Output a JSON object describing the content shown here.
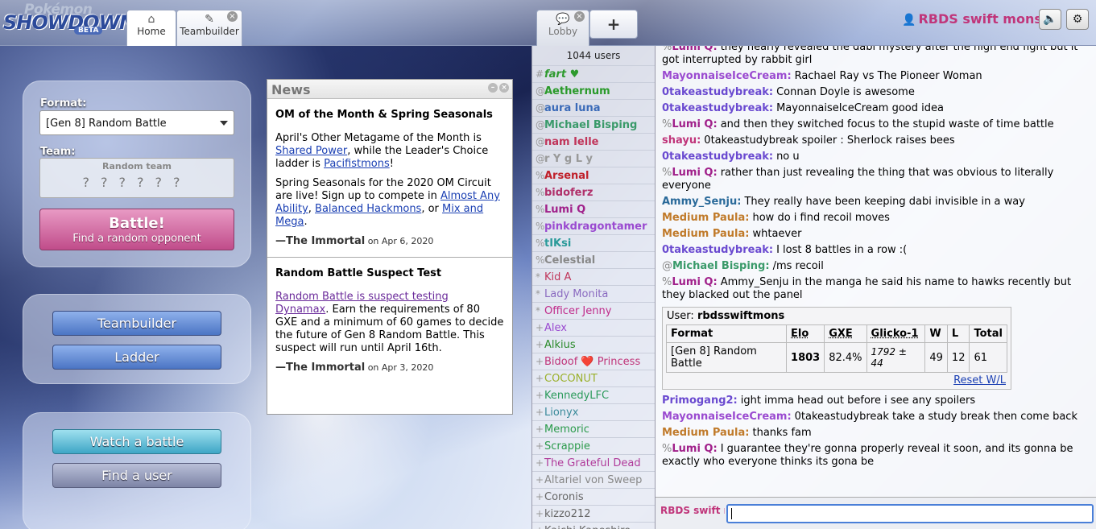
{
  "header": {
    "logo_top": "Pokémon",
    "logo_main": "SHOWDOWN",
    "logo_badge": "BETA",
    "tabs": [
      {
        "label": "Home"
      },
      {
        "label": "Teambuilder"
      },
      {
        "label": "Lobby"
      }
    ],
    "new_tab": "+",
    "username": "RBDS swift mons"
  },
  "menu": {
    "format_label": "Format:",
    "format_value": "[Gen 8] Random Battle",
    "team_label": "Team:",
    "team_value": "Random team",
    "battle_label": "Battle!",
    "battle_sub": "Find a random opponent",
    "teambuilder": "Teambuilder",
    "ladder": "Ladder",
    "watch": "Watch a battle",
    "find_user": "Find a user"
  },
  "news": {
    "title": "News",
    "items": [
      {
        "headline": "OM of the Month & Spring Seasonals",
        "p1_a": "April's Other Metagame of the Month is ",
        "p1_link1": "Shared Power",
        "p1_b": ", while the Leader's Choice ladder is ",
        "p1_link2": "Pacifistmons",
        "p1_c": "!",
        "p2_a": "Spring Seasonals for the 2020 OM Circuit are live! Sign up to compete in ",
        "p2_link1": "Almost Any Ability",
        "p2_b": ", ",
        "p2_link2": "Balanced Hackmons",
        "p2_c": ", or ",
        "p2_link3": "Mix and Mega",
        "p2_d": ".",
        "author": "—The Immortal",
        "date": "on Apr 6, 2020"
      },
      {
        "headline": "Random Battle Suspect Test",
        "p1_link1": "Random Battle is suspect testing Dynamax",
        "p1_a": ". Earn the requirements of 80 GXE and a minimum of 60 games to decide the future of Gen 8 Random Battle. This suspect will run until April 16th.",
        "author": "—The Immortal",
        "date": "on Apr 3, 2020"
      }
    ]
  },
  "userlist": {
    "count": "1044 users",
    "users": [
      {
        "rank": "#",
        "name": "fart ♥",
        "color": "#2e9a2e"
      },
      {
        "rank": "@",
        "name": "Aethernum",
        "color": "#2a9a2a"
      },
      {
        "rank": "@",
        "name": "aura luna",
        "color": "#3a6ab8"
      },
      {
        "rank": "@",
        "name": "Michael Bisping",
        "color": "#3a9a6a"
      },
      {
        "rank": "@",
        "name": "nam Ielle",
        "color": "#c0355a"
      },
      {
        "rank": "@",
        "name": "r Y g L y",
        "color": "#999999"
      },
      {
        "rank": "%",
        "name": "Arsenal",
        "color": "#c0202a"
      },
      {
        "rank": "%",
        "name": "bidoferz",
        "color": "#b0306a"
      },
      {
        "rank": "%",
        "name": "Lumi Q",
        "color": "#a0208a"
      },
      {
        "rank": "%",
        "name": "pinkdragontamer",
        "color": "#9a4ad0"
      },
      {
        "rank": "%",
        "name": "tIKsi",
        "color": "#2a9a9a"
      },
      {
        "rank": "%",
        "name": "Celestial",
        "color": "#888888"
      },
      {
        "rank": "*",
        "name": "Kid A",
        "color": "#c0355a"
      },
      {
        "rank": "*",
        "name": "Lady Monita",
        "color": "#8a6ac0"
      },
      {
        "rank": "*",
        "name": "Officer Jenny",
        "color": "#c02a8a"
      },
      {
        "rank": "+",
        "name": "Alex",
        "color": "#9a4ad0"
      },
      {
        "rank": "+",
        "name": "Alkius",
        "color": "#2a8a2a"
      },
      {
        "rank": "+",
        "name": "Bidoof ❤️ Princess",
        "color": "#c0357a"
      },
      {
        "rank": "+",
        "name": "COCONUT",
        "color": "#9ab02a"
      },
      {
        "rank": "+",
        "name": "KennedyLFC",
        "color": "#2a9a5a"
      },
      {
        "rank": "+",
        "name": "Lionyx",
        "color": "#3a8a9a"
      },
      {
        "rank": "+",
        "name": "Memoric",
        "color": "#2a9a4a"
      },
      {
        "rank": "+",
        "name": "Scrappie",
        "color": "#2a9a4a"
      },
      {
        "rank": "+",
        "name": "The Grateful Dead",
        "color": "#b03a9a"
      },
      {
        "rank": "+",
        "name": "Altariel von Sweep",
        "color": "#888888"
      },
      {
        "rank": "+",
        "name": "Coronis",
        "color": "#666666"
      },
      {
        "rank": "+",
        "name": "kizzo212",
        "color": "#666666"
      },
      {
        "rank": "+",
        "name": "Kaichi Kaneshiro",
        "color": "#666666"
      }
    ]
  },
  "chat": {
    "messages": [
      {
        "grp": "%",
        "name": "Lumi Q:",
        "color": "#a0208a",
        "text": "they nearly revealed the dabi mystery after the high end fight but it got interrupted by rabbit girl"
      },
      {
        "grp": "",
        "name": "MayonnaiseIceCream:",
        "color": "#9a4ad0",
        "text": "Rachael Ray vs The Pioneer Woman"
      },
      {
        "grp": "",
        "name": "0takeastudybreak:",
        "color": "#6a4ad0",
        "text": "Connan Doyle is awesome"
      },
      {
        "grp": "",
        "name": "0takeastudybreak:",
        "color": "#6a4ad0",
        "text": "MayonnaiseIceCream good idea"
      },
      {
        "grp": "%",
        "name": "Lumi Q:",
        "color": "#a0208a",
        "text": "and then they switched focus to the stupid waste of time battle"
      },
      {
        "grp": "",
        "name": "shayu:",
        "color": "#c0357a",
        "text": "0takeastudybreak spoiler : Sherlock raises bees"
      },
      {
        "grp": "",
        "name": "0takeastudybreak:",
        "color": "#6a4ad0",
        "text": "no u"
      },
      {
        "grp": "%",
        "name": "Lumi Q:",
        "color": "#a0208a",
        "text": "rather than just revealing the thing that was obvious to literally everyone"
      },
      {
        "grp": "",
        "name": "Ammy_Senju:",
        "color": "#2a6a9a",
        "text": "They really have been keeping dabi invisible in a way"
      },
      {
        "grp": "",
        "name": "Medium Paula:",
        "color": "#c07a2a",
        "text": "how do i find recoil moves"
      },
      {
        "grp": "",
        "name": "Medium Paula:",
        "color": "#c07a2a",
        "text": "whtaever"
      },
      {
        "grp": "",
        "name": "0takeastudybreak:",
        "color": "#6a4ad0",
        "text": "I lost 8 battles in a row :("
      },
      {
        "grp": "@",
        "name": "Michael Bisping:",
        "color": "#3a9a6a",
        "text": "/ms recoil"
      },
      {
        "grp": "%",
        "name": "Lumi Q:",
        "color": "#a0208a",
        "text": "Ammy_Senju in the manga he said his name to hawks recently but they blacked out the panel"
      }
    ],
    "stats": {
      "user_label": "User:",
      "user": "rbdsswiftmons",
      "headers": [
        "Format",
        "Elo",
        "GXE",
        "Glicko-1",
        "W",
        "L",
        "Total"
      ],
      "row": [
        "[Gen 8] Random Battle",
        "1803",
        "82.4%",
        "1792 ± 44",
        "49",
        "12",
        "61"
      ],
      "reset": "Reset W/L"
    },
    "messages2": [
      {
        "grp": "",
        "name": "Primogang2:",
        "color": "#6a4ad0",
        "text": "ight imma head out before i see any spoilers"
      },
      {
        "grp": "",
        "name": "MayonnaiseIceCream:",
        "color": "#9a4ad0",
        "text": "0takeastudybreak take a study break then come back"
      },
      {
        "grp": "",
        "name": "Medium Paula:",
        "color": "#c07a2a",
        "text": "thanks fam"
      },
      {
        "grp": "%",
        "name": "Lumi Q:",
        "color": "#a0208a",
        "text": "I guarantee they're gonna properly reveal it soon, and its gonna be exactly who everyone thinks its gona be"
      }
    ],
    "input_name": "RBDS swift mons",
    "input_value": ""
  }
}
